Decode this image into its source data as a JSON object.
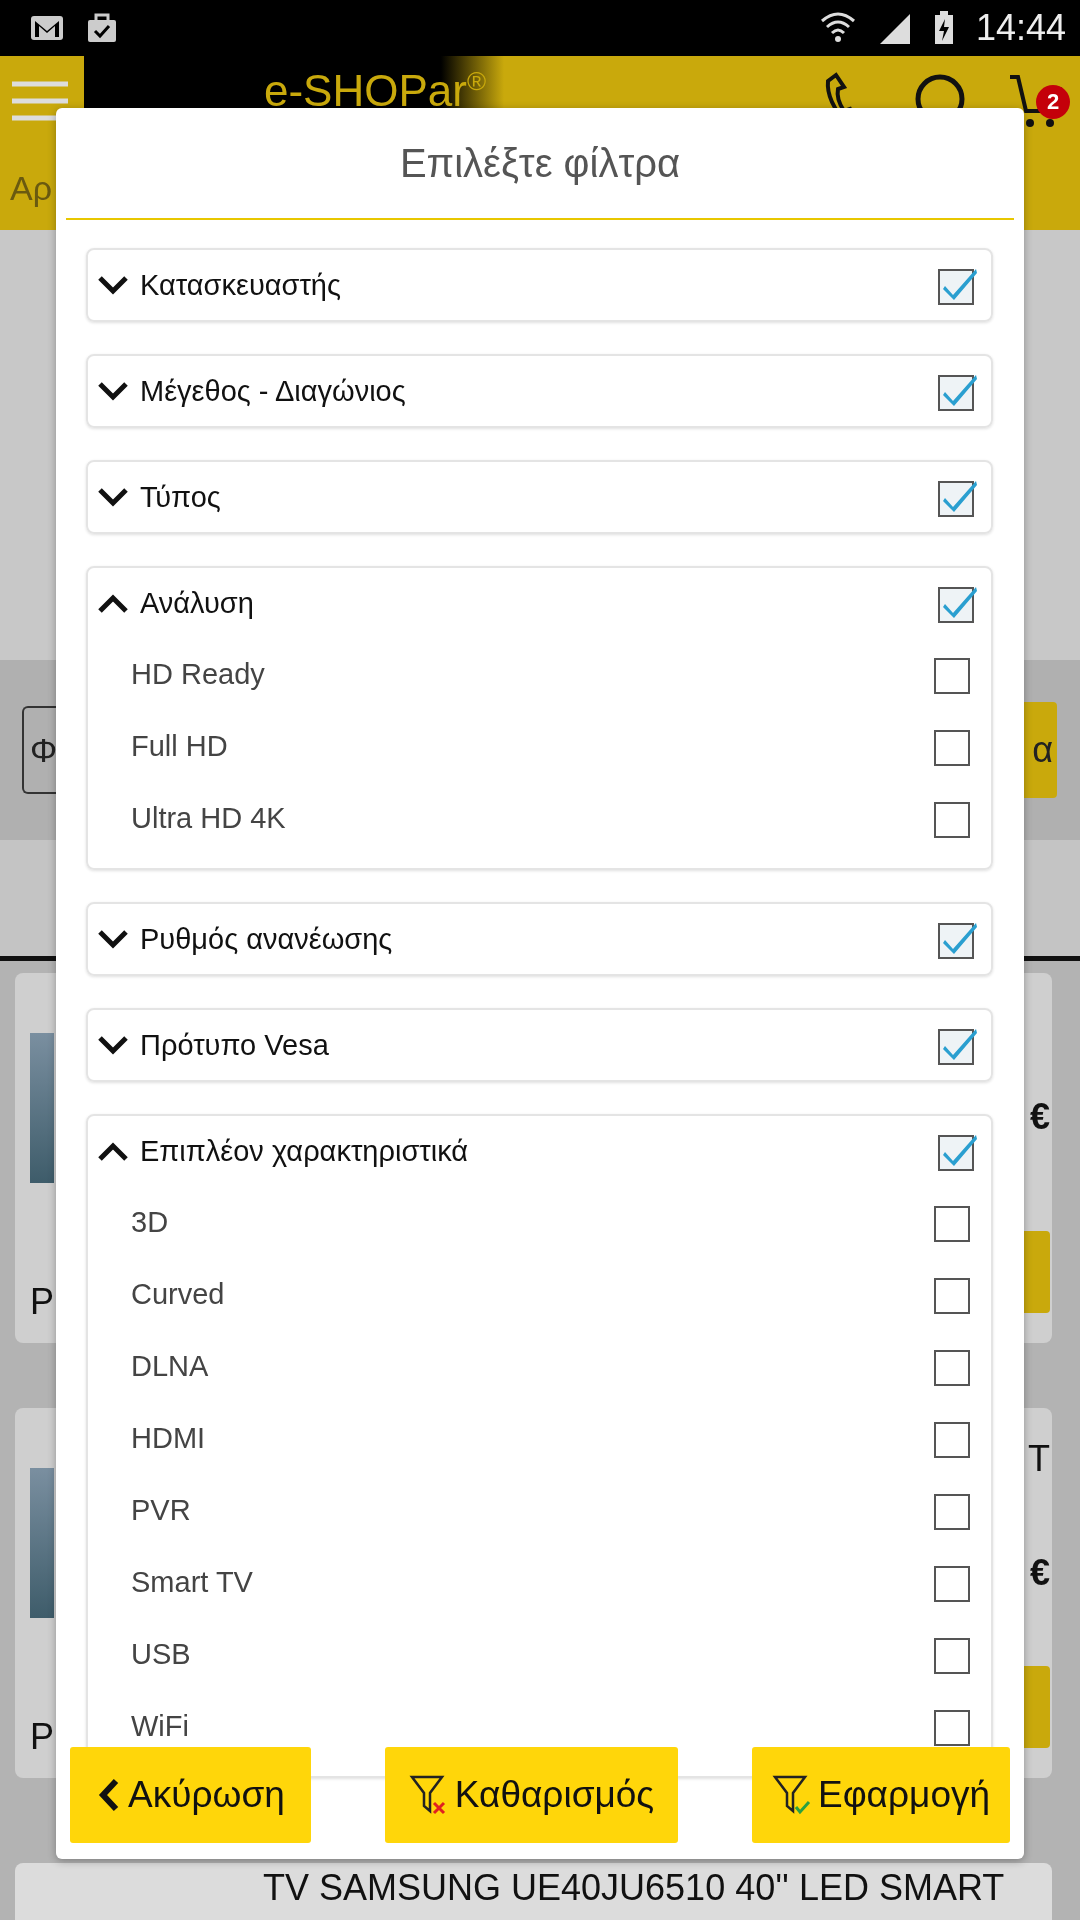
{
  "status_bar": {
    "time": "14:44"
  },
  "app_bar": {
    "logo": "e-SHOPar",
    "logo_mark": "®",
    "cart_count": "2"
  },
  "background": {
    "breadcrumb": "Αρ",
    "filter_button": "Φ",
    "sort_button": "α",
    "products": [
      {
        "price": "€",
        "label": "P"
      },
      {
        "title": "T",
        "price": "€",
        "label": "P"
      },
      {
        "title": "TV SAMSUNG UE40JU6510 40'' LED SMART"
      }
    ]
  },
  "dialog": {
    "title": "Επιλέξτε φίλτρα",
    "groups": [
      {
        "label": "Κατασκευαστής",
        "expanded": false,
        "checked": true
      },
      {
        "label": "Μέγεθος - Διαγώνιος",
        "expanded": false,
        "checked": true
      },
      {
        "label": "Τύπος",
        "expanded": false,
        "checked": true
      },
      {
        "label": "Ανάλυση",
        "expanded": true,
        "checked": true,
        "options": [
          {
            "label": "HD Ready",
            "checked": false
          },
          {
            "label": "Full HD",
            "checked": false
          },
          {
            "label": "Ultra HD 4K",
            "checked": false
          }
        ]
      },
      {
        "label": "Ρυθμός ανανέωσης",
        "expanded": false,
        "checked": true
      },
      {
        "label": "Πρότυπο Vesa",
        "expanded": false,
        "checked": true
      },
      {
        "label": "Επιπλέον χαρακτηριστικά",
        "expanded": true,
        "checked": true,
        "options": [
          {
            "label": "3D",
            "checked": false
          },
          {
            "label": "Curved",
            "checked": false
          },
          {
            "label": "DLNA",
            "checked": false
          },
          {
            "label": "HDMI",
            "checked": false
          },
          {
            "label": "PVR",
            "checked": false
          },
          {
            "label": "Smart TV",
            "checked": false
          },
          {
            "label": "USB",
            "checked": false
          },
          {
            "label": "WiFi",
            "checked": false
          }
        ]
      }
    ],
    "buttons": [
      {
        "kind": "back",
        "label": "Ακύρωση"
      },
      {
        "kind": "clear",
        "label": "Καθαρισμός"
      },
      {
        "kind": "apply",
        "label": "Εφαρμογή"
      }
    ]
  }
}
